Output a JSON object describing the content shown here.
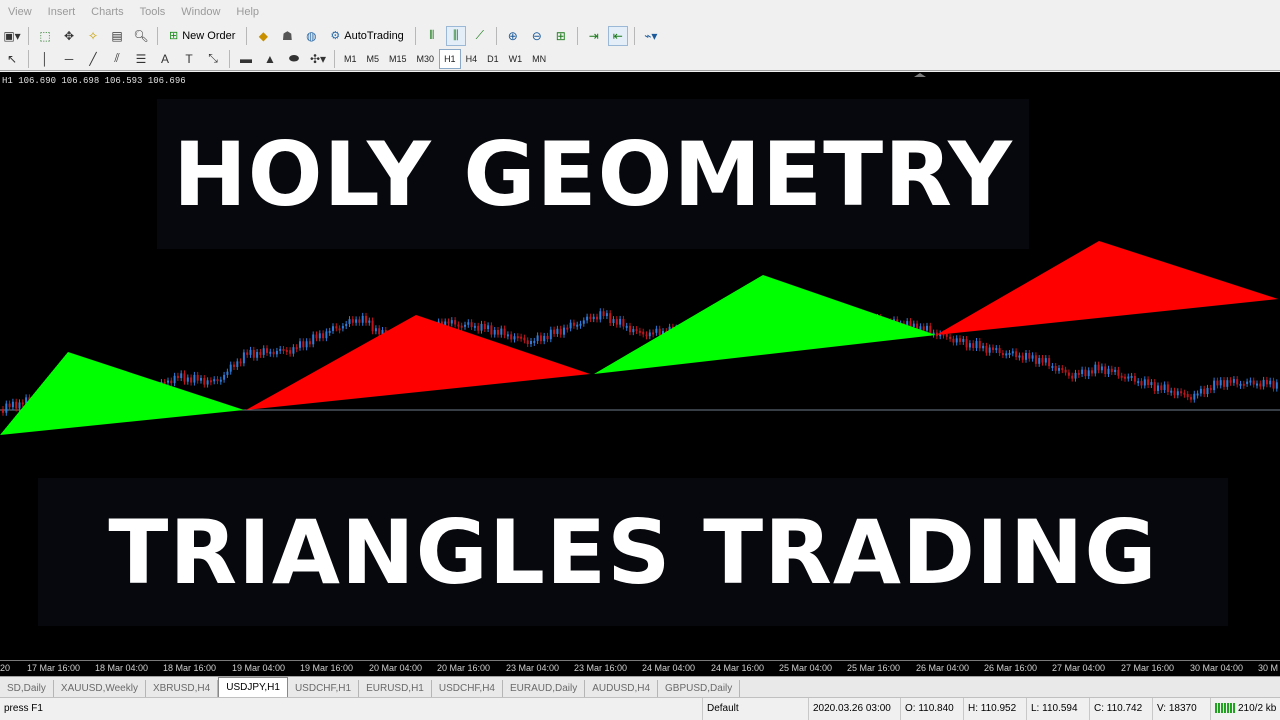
{
  "menu": [
    "View",
    "Insert",
    "Charts",
    "Tools",
    "Window",
    "Help"
  ],
  "toolbar": {
    "new_order": "New Order",
    "autotrading": "AutoTrading",
    "timeframes": [
      "M1",
      "M5",
      "M15",
      "M30",
      "H1",
      "H4",
      "D1",
      "W1",
      "MN"
    ],
    "active_timeframe": "H1"
  },
  "chart": {
    "price_readout": "H1  106.690 106.698 106.593 106.696",
    "title_top": "HOLY GEOMETRY",
    "title_bottom": "TRIANGLES TRADING",
    "colors": {
      "bull": "#2f7bd9",
      "bear": "#c0141c",
      "triangle_green": "#00ff00",
      "triangle_red": "#ff0000",
      "background": "#000000"
    },
    "x_ticks": [
      "20",
      "17 Mar 16:00",
      "18 Mar 04:00",
      "18 Mar 16:00",
      "19 Mar 04:00",
      "19 Mar 16:00",
      "20 Mar 04:00",
      "20 Mar 16:00",
      "23 Mar 04:00",
      "23 Mar 16:00",
      "24 Mar 04:00",
      "24 Mar 16:00",
      "25 Mar 04:00",
      "25 Mar 16:00",
      "26 Mar 04:00",
      "26 Mar 16:00",
      "27 Mar 04:00",
      "27 Mar 16:00",
      "30 Mar 04:00",
      "30 M"
    ]
  },
  "tabs": [
    {
      "label": "SD,Daily",
      "active": false
    },
    {
      "label": "XAUUSD,Weekly",
      "active": false
    },
    {
      "label": "XBRUSD,H4",
      "active": false
    },
    {
      "label": "USDJPY,H1",
      "active": true
    },
    {
      "label": "USDCHF,H1",
      "active": false
    },
    {
      "label": "EURUSD,H1",
      "active": false
    },
    {
      "label": "USDCHF,H4",
      "active": false
    },
    {
      "label": "EURAUD,Daily",
      "active": false
    },
    {
      "label": "AUDUSD,H4",
      "active": false
    },
    {
      "label": "GBPUSD,Daily",
      "active": false
    }
  ],
  "status": {
    "help": "press F1",
    "profile": "Default",
    "datetime": "2020.03.26 03:00",
    "open": "O: 110.840",
    "high": "H: 110.952",
    "low": "L: 110.594",
    "close": "C: 110.742",
    "volume": "V: 18370",
    "traffic": "210/2 kb"
  }
}
